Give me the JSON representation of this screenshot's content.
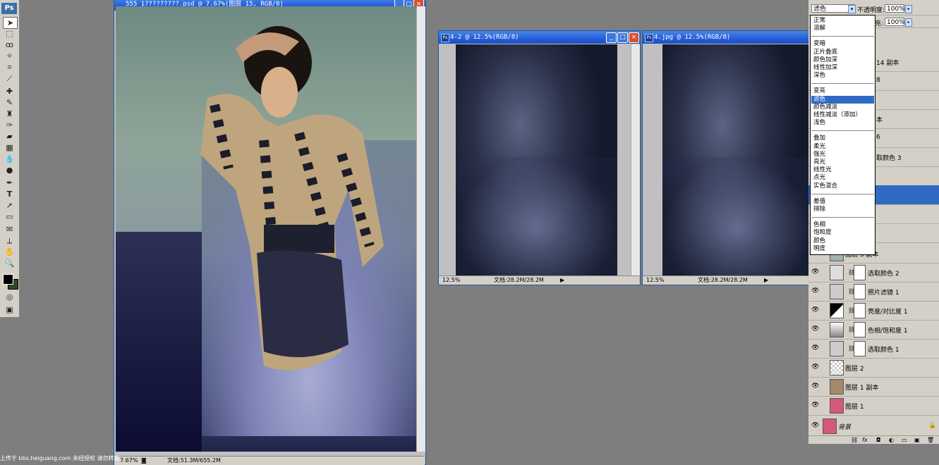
{
  "tools": {
    "ps_logo": "Ps",
    "icons": [
      "move",
      "marquee",
      "lasso",
      "magic-wand",
      "crop",
      "slice",
      "healing",
      "brush",
      "stamp",
      "history-brush",
      "eraser",
      "gradient",
      "blur",
      "dodge",
      "pen",
      "type",
      "path-select",
      "shape",
      "notes",
      "eyedropper",
      "hand",
      "zoom"
    ],
    "type_glyph": "T"
  },
  "main_doc": {
    "title": "555_1?????????.psd @ 7.67%(图层 15, RGB/8)",
    "zoom": "7.67%",
    "doc_info": "文档:51.3M/655.2M"
  },
  "doc2": {
    "title": "4-2 @ 12.5%(RGB/8)",
    "zoom": "12.5%",
    "doc_info": "文档:28.2M/28.2M"
  },
  "doc3": {
    "title": "4.jpg @ 12.5%(RGB/8)",
    "zoom": "12.5%",
    "doc_info": "文档:28.2M/28.2M"
  },
  "layers_panel": {
    "blend_mode": "滤色",
    "opacity_label": "不透明度:",
    "opacity_value": "100%",
    "fill_label": "充:",
    "fill_value": "100%",
    "partial_labels": [
      "14 副本",
      "8",
      "本",
      "6",
      "取颜色 3"
    ],
    "layers": [
      {
        "name": "图层 3 副本"
      },
      {
        "name": "选取颜色 2"
      },
      {
        "name": "照片滤镜 1"
      },
      {
        "name": "亮度/对比度 1"
      },
      {
        "name": "色相/饱和度 1"
      },
      {
        "name": "选取颜色 1"
      },
      {
        "name": "图层 2"
      },
      {
        "name": "图层 1 副本"
      },
      {
        "name": "图层 1"
      },
      {
        "name": "背景"
      }
    ]
  },
  "blend_menu": {
    "groups": [
      [
        "正常",
        "溶解"
      ],
      [
        "变暗",
        "正片叠底",
        "颜色加深",
        "线性加深",
        "深色"
      ],
      [
        "变亮",
        "滤色",
        "颜色减淡",
        "线性减淡（添加）",
        "浅色"
      ],
      [
        "叠加",
        "柔光",
        "强光",
        "亮光",
        "线性光",
        "点光",
        "实色混合"
      ],
      [
        "差值",
        "排除"
      ],
      [
        "色相",
        "饱和度",
        "颜色",
        "明度"
      ]
    ],
    "selected": "滤色"
  },
  "watermark": "上传于 bbs.heiguang.com  未经授权 请勿转载",
  "colors": {
    "title_bar": "#245edb",
    "highlight": "#316ac5",
    "canvas_bg": "#7e7e7e"
  }
}
